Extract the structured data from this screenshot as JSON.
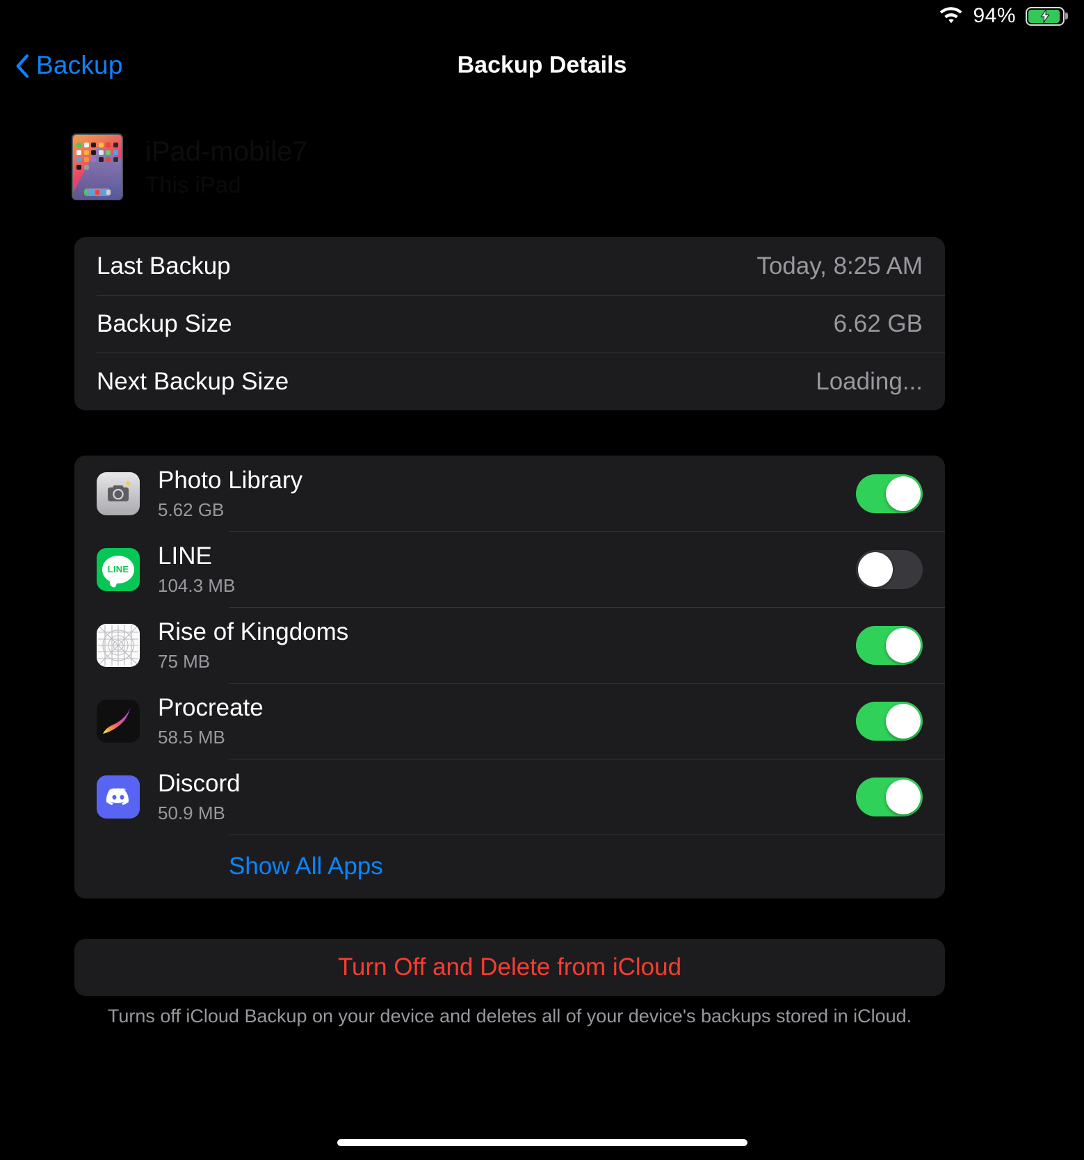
{
  "status_bar": {
    "wifi_icon": "wifi-icon",
    "battery_percent": "94%",
    "battery_icon": "battery-charging-icon",
    "battery_level": 94
  },
  "nav": {
    "back_icon": "chevron-left-icon",
    "back_label": "Backup",
    "title": "Backup Details"
  },
  "device": {
    "thumbnail_icon": "ipad-thumbnail",
    "name": "iPad-mobile7",
    "subtitle": "This iPad"
  },
  "info": {
    "rows": [
      {
        "label": "Last Backup",
        "value": "Today, 8:25 AM"
      },
      {
        "label": "Backup Size",
        "value": "6.62 GB"
      },
      {
        "label": "Next Backup Size",
        "value": "Loading..."
      }
    ]
  },
  "apps": {
    "items": [
      {
        "icon": "photos-app-icon",
        "name": "Photo Library",
        "size": "5.62 GB",
        "enabled": true
      },
      {
        "icon": "line-app-icon",
        "name": "LINE",
        "size": "104.3 MB",
        "enabled": false
      },
      {
        "icon": "rok-app-icon",
        "name": "Rise of Kingdoms",
        "size": "75 MB",
        "enabled": true
      },
      {
        "icon": "procreate-app-icon",
        "name": "Procreate",
        "size": "58.5 MB",
        "enabled": true
      },
      {
        "icon": "discord-app-icon",
        "name": "Discord",
        "size": "50.9 MB",
        "enabled": true
      }
    ],
    "show_all_label": "Show All Apps"
  },
  "danger": {
    "button_label": "Turn Off and Delete from iCloud",
    "footnote": "Turns off iCloud Backup on your device and deletes all of your device's backups stored in iCloud."
  },
  "colors": {
    "accent_blue": "#0a84ff",
    "destructive_red": "#ff3b30",
    "toggle_on_green": "#30d158",
    "card_background": "#1c1c1e",
    "page_background": "#000000",
    "secondary_text": "#98989f"
  }
}
